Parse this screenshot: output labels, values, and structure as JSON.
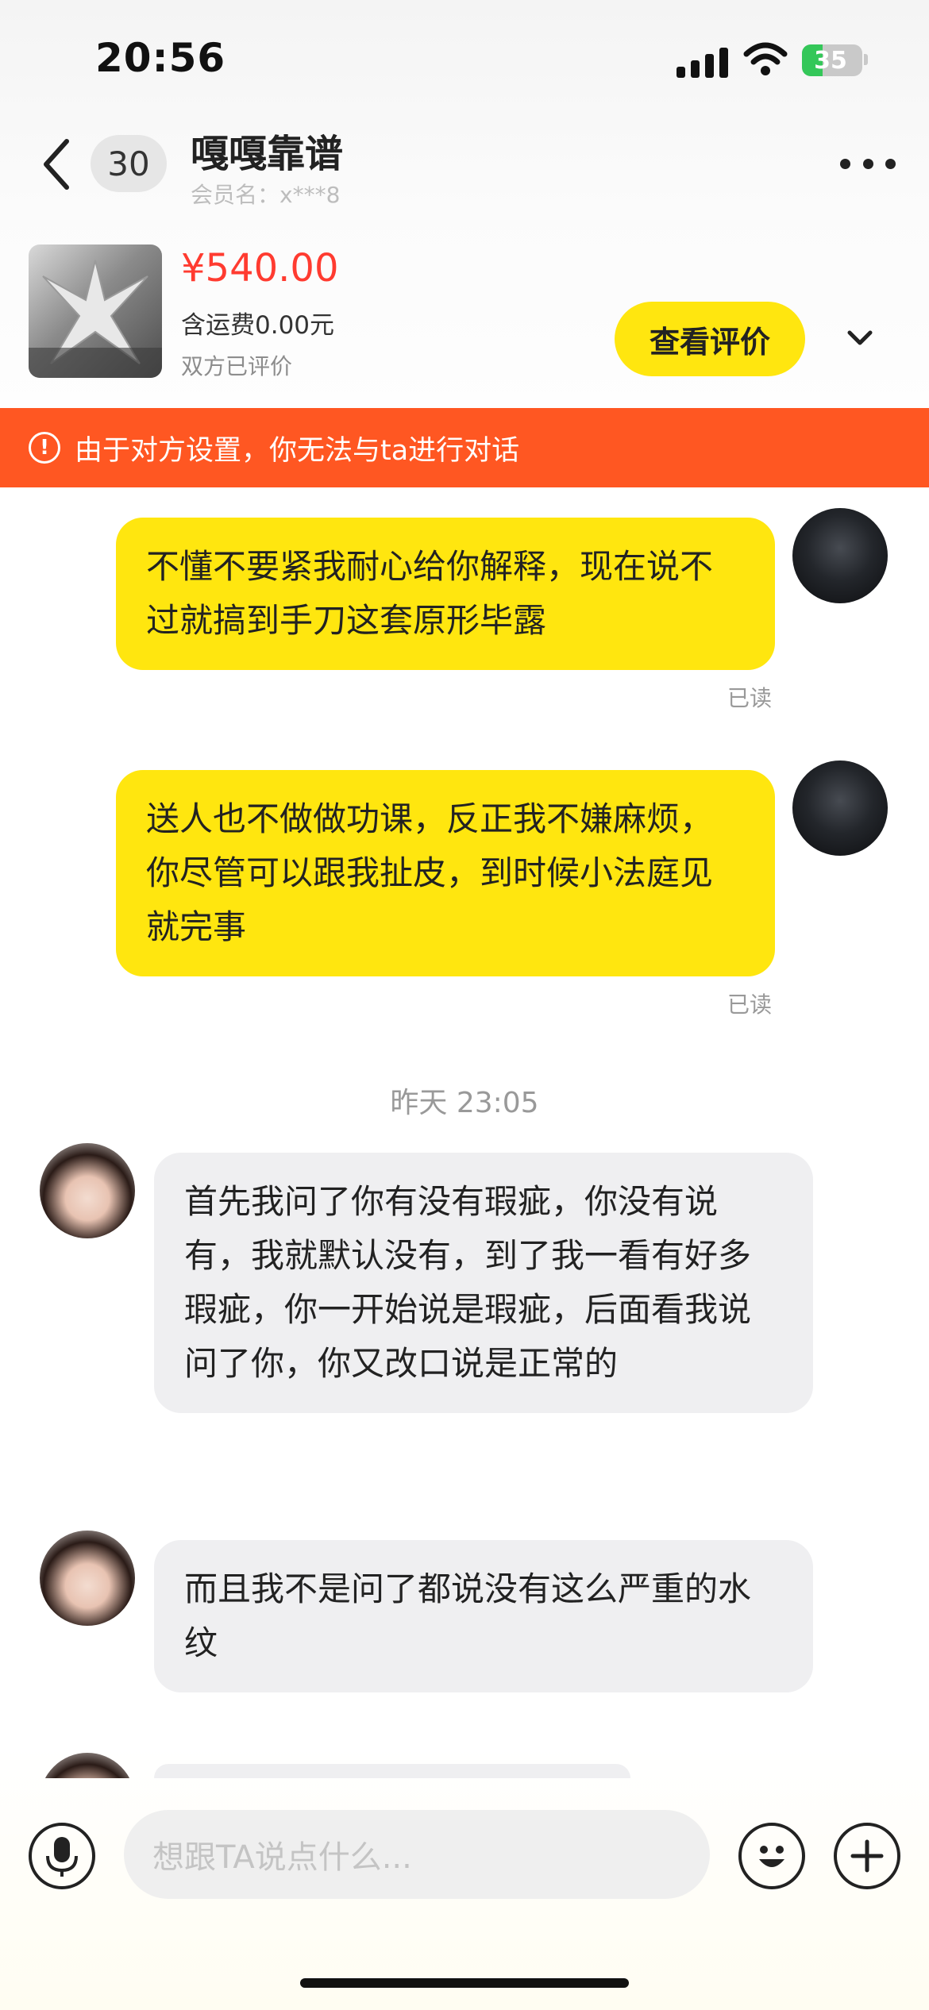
{
  "status_bar": {
    "time": "20:56",
    "battery": "35"
  },
  "header": {
    "unread_count": "30",
    "contact_name": "嘎嘎靠谱",
    "member_label": "会员名：x***8"
  },
  "product": {
    "price": "¥540.00",
    "shipping": "含运费0.00元",
    "status": "双方已评价",
    "review_button": "查看评价"
  },
  "banner": {
    "text": "由于对方设置，你无法与ta进行对话"
  },
  "messages": [
    {
      "sender": "me",
      "text": "不懂不要紧我耐心给你解释，现在说不过就搞到手刀这套原形毕露",
      "status": "已读"
    },
    {
      "sender": "me",
      "text": "送人也不做做功课，反正我不嫌麻烦，你尽管可以跟我扯皮，到时候小法庭见就完事",
      "status": "已读"
    },
    {
      "sender": "other",
      "text": "首先我问了你有没有瑕疵，你没有说有，我就默认没有，到了我一看有好多瑕疵，你一开始说是瑕疵，后面看我说问了你，你又改口说是正常的"
    },
    {
      "sender": "other",
      "text": "而且我不是问了都说没有这么严重的水纹"
    }
  ],
  "timestamp": "昨天 23:05",
  "input": {
    "placeholder": "想跟TA说点什么..."
  },
  "colors": {
    "accent_yellow": "#ffe60f",
    "price_red": "#ff3b30",
    "banner_orange": "#ff5722"
  }
}
